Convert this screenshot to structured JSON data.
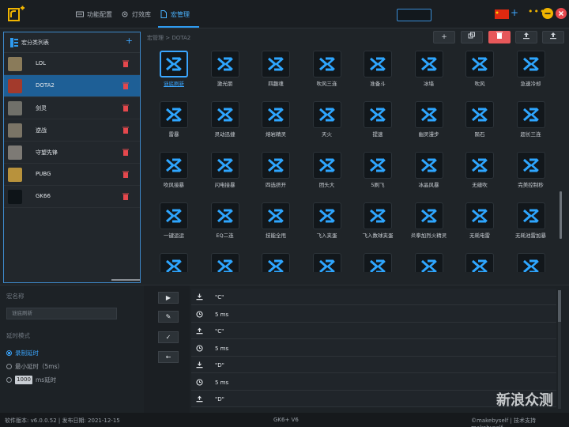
{
  "topbar": {
    "nav": [
      "功能配置",
      "灯效库",
      "宏管理"
    ],
    "active_nav": "宏管理",
    "add_label": "+",
    "dots": "•••",
    "colors": {
      "accent": "#2e9bf0",
      "minimize": "#f0b400",
      "close": "#e5484d"
    }
  },
  "macro_list": {
    "title": "宏分类列表",
    "add_label": "+",
    "items": [
      {
        "name": "LOL",
        "thumb_color": "#8a7b5a"
      },
      {
        "name": "DOTA2",
        "thumb_color": "#a33a2c",
        "selected": true
      },
      {
        "name": "剑灵",
        "thumb_color": "#70706a"
      },
      {
        "name": "逆战",
        "thumb_color": "#7a7466"
      },
      {
        "name": "守望先锋",
        "thumb_color": "#7d7a75"
      },
      {
        "name": "PUBG",
        "thumb_color": "#b8923c"
      },
      {
        "name": "GK66",
        "thumb_color": "#0e1418"
      }
    ]
  },
  "breadcrumb": "宏管理 > DOTA2",
  "toolbar": {
    "add": "+",
    "copy": "⧉",
    "delete": "🗑",
    "export": "⇪",
    "import": "⇪"
  },
  "macros": [
    "谜底刷新",
    "激光朋",
    "四趣魂",
    "吹风三连",
    "准备斗",
    "冰墙",
    "吹风",
    "急速冷却",
    "雷暴",
    "灵动迅捷",
    "熔岩精灵",
    "天火",
    "提速",
    "幽灵漫步",
    "陨石",
    "超长三连",
    "吹风接暴",
    "闪电接暴",
    "四选挤开",
    "团头大",
    "5刷飞",
    "冰晶风暴",
    "无缝吹",
    "完美控制秒",
    "一键运运",
    "EQ二连",
    "技能全甩",
    "飞入夹蛋",
    "飞入数球夹蛋",
    "炎拳加烈火精灵",
    "无耗电雷",
    "无耗池雷加暴",
    "",
    "",
    "",
    "",
    "",
    "",
    "",
    ""
  ],
  "selected_macro_index": 0,
  "settings": {
    "name_label": "宏名称",
    "name_value": "谜底刷新",
    "delay_label": "延时模式",
    "options": [
      {
        "label": "录制延时",
        "selected": true
      },
      {
        "label": "最小延时（5ms）",
        "selected": false
      },
      {
        "label": "ms延时",
        "value": "1000",
        "selected": false
      }
    ]
  },
  "side_buttons": {
    "play": "▶",
    "edit": "✎",
    "confirm": "✓",
    "back": "←"
  },
  "steps": [
    {
      "icon": "download-icon",
      "text": "\"C\""
    },
    {
      "icon": "timer-icon",
      "text": "5 ms"
    },
    {
      "icon": "upload-icon",
      "text": "\"C\""
    },
    {
      "icon": "timer-icon",
      "text": "5 ms"
    },
    {
      "icon": "download-icon",
      "text": "\"D\""
    },
    {
      "icon": "timer-icon",
      "text": "5 ms"
    },
    {
      "icon": "upload-icon",
      "text": "\"D\""
    }
  ],
  "footer": {
    "version": "软件版本: v6.0.0.52 | 发布日期: 2021-12-15",
    "device": "GK6+ V6",
    "support": "©makebyself | 技术支持 makebyself"
  },
  "watermark": "新浪众测"
}
